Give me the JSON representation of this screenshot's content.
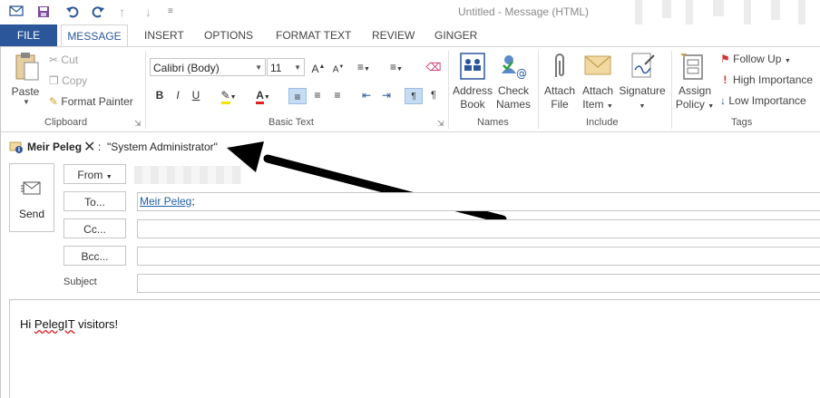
{
  "window": {
    "title": "Untitled - Message (HTML)"
  },
  "quick_access": [
    "mail-icon",
    "save-icon",
    "undo-icon",
    "redo-icon",
    "up-icon",
    "down-icon",
    "customize-icon"
  ],
  "tabs": {
    "file": "FILE",
    "items": [
      "MESSAGE",
      "INSERT",
      "OPTIONS",
      "FORMAT TEXT",
      "REVIEW",
      "GINGER"
    ],
    "active": "MESSAGE"
  },
  "ribbon": {
    "clipboard": {
      "paste": "Paste",
      "cut": "Cut",
      "copy": "Copy",
      "format_painter": "Format Painter",
      "label": "Clipboard"
    },
    "basic_text": {
      "font": "Calibri (Body)",
      "size": "11",
      "label": "Basic Text"
    },
    "names": {
      "address_book": [
        "Address",
        "Book"
      ],
      "check_names": [
        "Check",
        "Names"
      ],
      "label": "Names"
    },
    "include": {
      "attach_file": [
        "Attach",
        "File"
      ],
      "attach_item": [
        "Attach",
        "Item"
      ],
      "signature": "Signature",
      "label": "Include"
    },
    "tags": {
      "assign_policy": [
        "Assign",
        "Policy"
      ],
      "follow_up": "Follow Up",
      "high_importance": "High Importance",
      "low_importance": "Low Importance",
      "label": "Tags"
    }
  },
  "info_bar": {
    "sender": "Meir Peleg",
    "separator": ":",
    "message": "\"System Administrator\""
  },
  "form": {
    "send": "Send",
    "from": "From",
    "to": "To...",
    "to_value": "Meir Peleg",
    "to_suffix": ";",
    "cc": "Cc...",
    "bcc": "Bcc...",
    "subject": "Subject"
  },
  "body": {
    "text_before": "Hi ",
    "text_misspelled": "PelegIT",
    "text_after": " visitors!"
  },
  "colors": {
    "accent": "#2b579a",
    "selected": "#c5dcf3",
    "link": "#1f5fa8",
    "error_underline": "#e02020"
  }
}
